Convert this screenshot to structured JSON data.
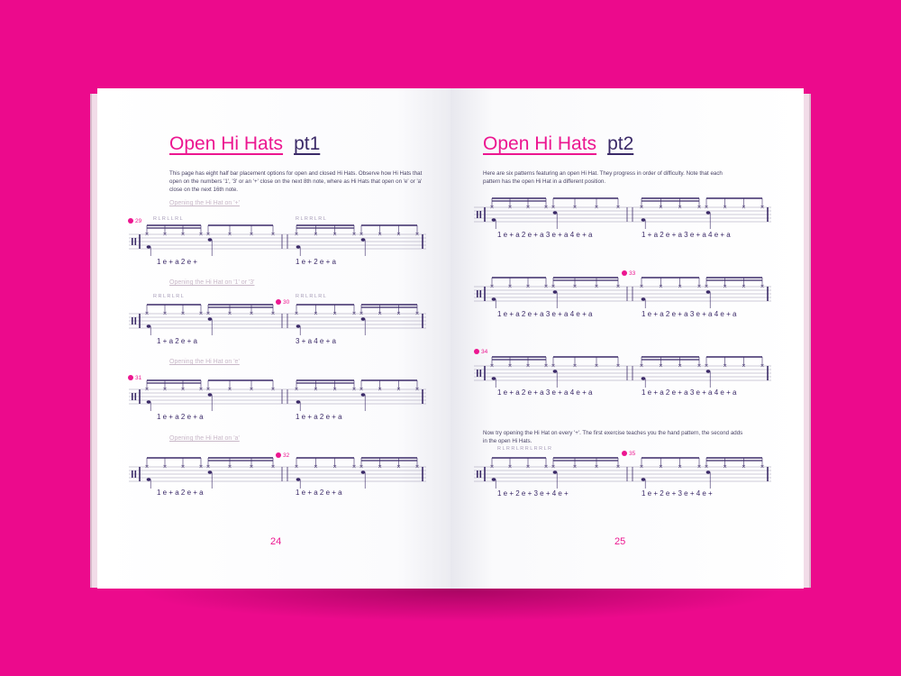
{
  "colors": {
    "background": "#ec0a8c",
    "accent": "#ec1690",
    "ink": "#3b2a68"
  },
  "left_page": {
    "title_main": "Open Hi Hats",
    "title_part": "pt1",
    "intro": "This page has eight half bar placement options for open and closed Hi Hats.  Observe how Hi Hats that open on the numbers '1', '3' or an '+' close on the next 8th note, where as Hi Hats that open on 'e' or 'a' close on the next 16th note.",
    "sections": [
      {
        "heading": "Opening the Hi Hat on '+'",
        "marker": "29",
        "sticking_1": "R  L  R  L  L  R  L",
        "sticking_2": "R  L  R  R  L  R  L",
        "counts_1": "1    e    +    a    2    e    +",
        "counts_2": "1    e    +    2    e    +    a"
      },
      {
        "heading": "Opening the Hi Hat on '1' or '3'",
        "marker": "30",
        "sticking_1": "R  R  L  R  L  R  L",
        "sticking_2": "R  R  L  R  L  R  L",
        "counts_1": "1    +    a    2    e    +    a",
        "counts_2": "3    +    a    4    e    +    a"
      },
      {
        "heading": "Opening the Hi Hat on 'e'",
        "marker": "31",
        "sticking_1": "",
        "sticking_2": "",
        "counts_1": "1    e    +    a    2    e    +    a",
        "counts_2": "1    e    +    a    2    e    +    a"
      },
      {
        "heading": "Opening the Hi Hat on 'a'",
        "marker": "32",
        "sticking_1": "",
        "sticking_2": "",
        "counts_1": "1    e    +    a    2    e    +    a",
        "counts_2": "1    e    +    a    2    e    +    a"
      }
    ],
    "page_number": "24"
  },
  "right_page": {
    "title_main": "Open Hi Hats",
    "title_part": "pt2",
    "intro": "Here are six patterns featuring an open Hi Hat.  They progress in order of difficulty.  Note that each pattern has the open Hi Hat in a different position.",
    "rows": [
      {
        "marker": "",
        "counts": "1  e  +  a  2  e  +  a  3  e  +  a  4  e  +  a",
        "counts_2": "1  +  a  2  e  +  a  3  e  +  a  4  e  +  a"
      },
      {
        "marker": "33",
        "counts": "1  e  +  a  2  e  +  a  3  e  +  a  4  e  +  a",
        "counts_2": "1  e  +  a  2  e  +  a  3  e  +  a  4  e  +  a"
      },
      {
        "marker": "34",
        "counts": "1  e  +  a  2  e  +  a  3  e  +  a  4  e  +  a",
        "counts_2": "1  e  +  a  2  e  +  a  3  e  +  a  4  e  +  a"
      }
    ],
    "second_intro": "Now try opening the Hi Hat on every '+'.  The first exercise teaches you the hand pattern, the second adds in the open Hi Hats.",
    "last_row": {
      "marker": "35",
      "sticking": "R  L  R     R  L  R     R  L  R     R  L  R",
      "counts": "1  e  +   2  e  +   3  e  +   4  e  +",
      "counts_2": "1  e  +   2  e  +   3  e  +   4  e  +"
    },
    "page_number": "25"
  }
}
